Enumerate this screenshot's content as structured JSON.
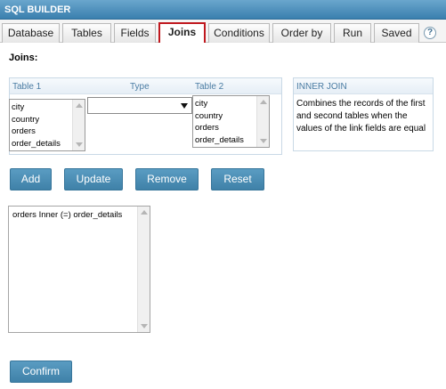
{
  "app": {
    "title": "SQL BUILDER"
  },
  "tabs": [
    {
      "label": "Database"
    },
    {
      "label": "Tables"
    },
    {
      "label": "Fields"
    },
    {
      "label": "Joins",
      "active": true
    },
    {
      "label": "Conditions"
    },
    {
      "label": "Order by"
    },
    {
      "label": "Run"
    },
    {
      "label": "Saved"
    }
  ],
  "help": {
    "label": "?"
  },
  "section": {
    "label": "Joins:"
  },
  "join_editor": {
    "headers": {
      "table1": "Table 1",
      "type": "Type",
      "table2": "Table 2"
    },
    "table1_items": [
      "city",
      "country",
      "orders",
      "order_details"
    ],
    "type_value": "",
    "table2_items": [
      "city",
      "country",
      "orders",
      "order_details"
    ]
  },
  "info": {
    "title": "INNER JOIN",
    "description": "Combines the records of the first and second tables when the values of the link fields are equal"
  },
  "buttons": {
    "add": "Add",
    "update": "Update",
    "remove": "Remove",
    "reset": "Reset",
    "confirm": "Confirm"
  },
  "joins_list": [
    "orders Inner (=) order_details"
  ],
  "colors": {
    "titlebar": "#4a8dbb",
    "button": "#4a8db5",
    "active_tab_border": "#c0181e",
    "header_text": "#4a7ca3"
  }
}
